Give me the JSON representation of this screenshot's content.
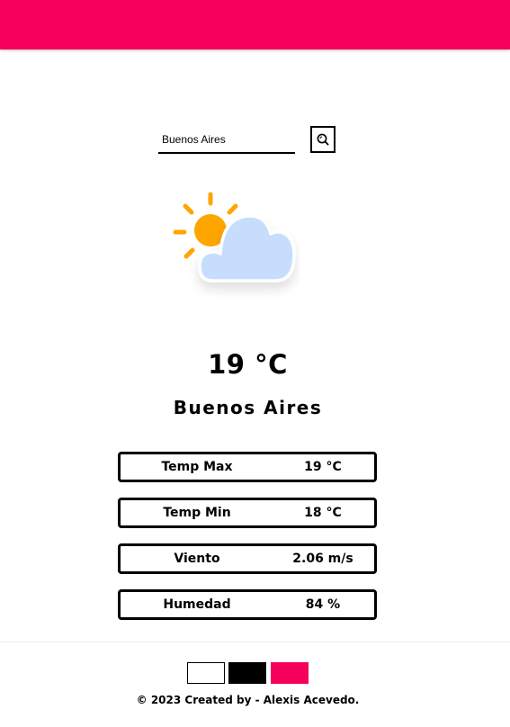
{
  "colors": {
    "accent": "#f5005a",
    "sun": "#ffa500",
    "cloud": "#c6defc",
    "black": "#000000",
    "white": "#ffffff"
  },
  "search": {
    "value": "Buenos Aires",
    "icon": "search-icon"
  },
  "weather": {
    "icon": "partly-cloudy-icon",
    "temperature": "19 °C",
    "city": "Buenos Aires"
  },
  "stats": [
    {
      "label": "Temp Max",
      "value": "19 °C"
    },
    {
      "label": "Temp Min",
      "value": "18 °C"
    },
    {
      "label": "Viento",
      "value": "2.06 m/s"
    },
    {
      "label": "Humedad",
      "value": "84 %"
    }
  ],
  "footer": {
    "themes": [
      {
        "name": "white",
        "color": "#ffffff"
      },
      {
        "name": "black",
        "color": "#000000"
      },
      {
        "name": "pink",
        "color": "#f5005a"
      }
    ],
    "copyright_symbol": "©",
    "credit": "2023 Created by - Alexis Acevedo."
  }
}
